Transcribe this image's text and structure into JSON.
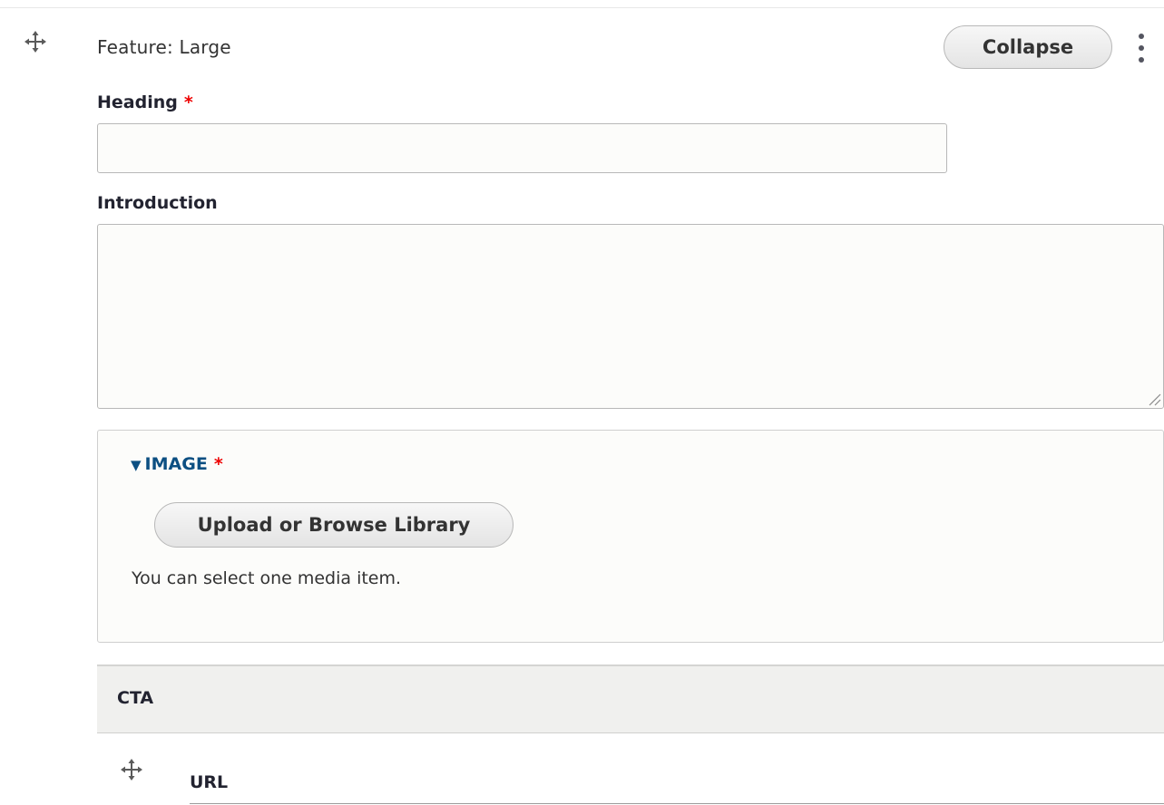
{
  "paragraph": {
    "type_label": "Feature: Large",
    "collapse_label": "Collapse"
  },
  "fields": {
    "heading": {
      "label": "Heading",
      "required_marker": "*",
      "value": ""
    },
    "introduction": {
      "label": "Introduction",
      "value": ""
    },
    "image": {
      "summary_label": "IMAGE",
      "expanded_marker": "▼",
      "required_marker": "*",
      "upload_label": "Upload or Browse Library",
      "help_text": "You can select one media item."
    }
  },
  "cta": {
    "section_title": "CTA",
    "url_label": "URL"
  },
  "icons": {
    "drag": "move-arrows-icon",
    "menu": "vertical-ellipsis-icon",
    "resize": "resize-grip-icon"
  },
  "colors": {
    "link": "#0c4f82",
    "required": "#e00000",
    "section_bg": "#f0f0ee"
  }
}
